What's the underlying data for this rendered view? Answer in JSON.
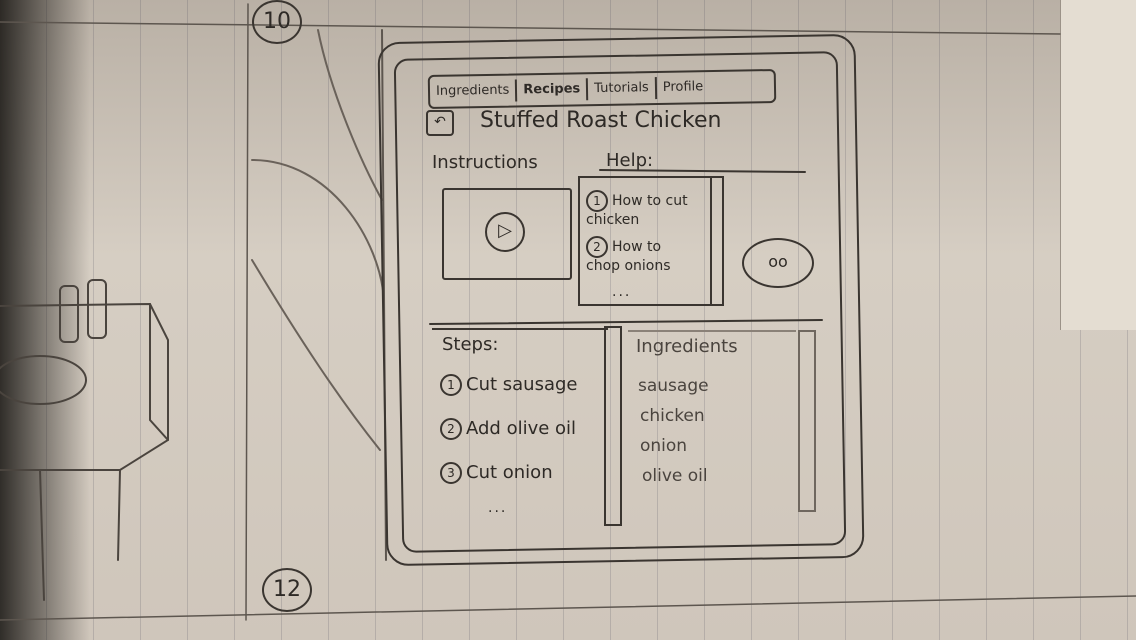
{
  "tabs": [
    "Ingredients",
    "Recipes",
    "Tutorials",
    "Profile"
  ],
  "back_label": "↶",
  "recipe_title": "Stuffed Roast Chicken",
  "instructions_label": "Instructions",
  "help_label": "Help:",
  "help_items": [
    "How to cut chicken",
    "How to chop onions"
  ],
  "help_more": "...",
  "steps_label": "Steps:",
  "steps": [
    "Cut sausage",
    "Add olive oil",
    "Cut onion"
  ],
  "steps_more": "...",
  "ingredients_label": "Ingredients",
  "ingredients": [
    "sausage",
    "chicken",
    "onion",
    "olive oil"
  ],
  "page_numbers": [
    "10",
    "12"
  ]
}
